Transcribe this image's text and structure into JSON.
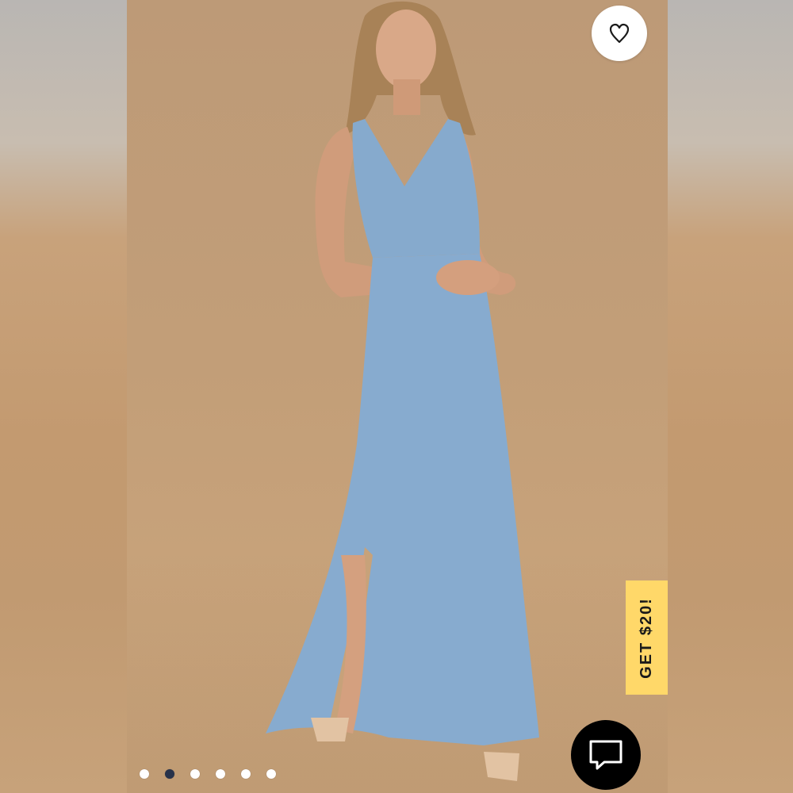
{
  "product_image": {
    "alt": "",
    "background_color": "#c29e78",
    "dress_color": "#86aacd"
  },
  "favorite_button": {
    "icon": "heart-outline-icon"
  },
  "promo_tab": {
    "label": "GET $20!",
    "color": "#ffd869"
  },
  "chat_button": {
    "icon": "chat-bubble-icon"
  },
  "pagination": {
    "total": 6,
    "active_index": 1
  }
}
